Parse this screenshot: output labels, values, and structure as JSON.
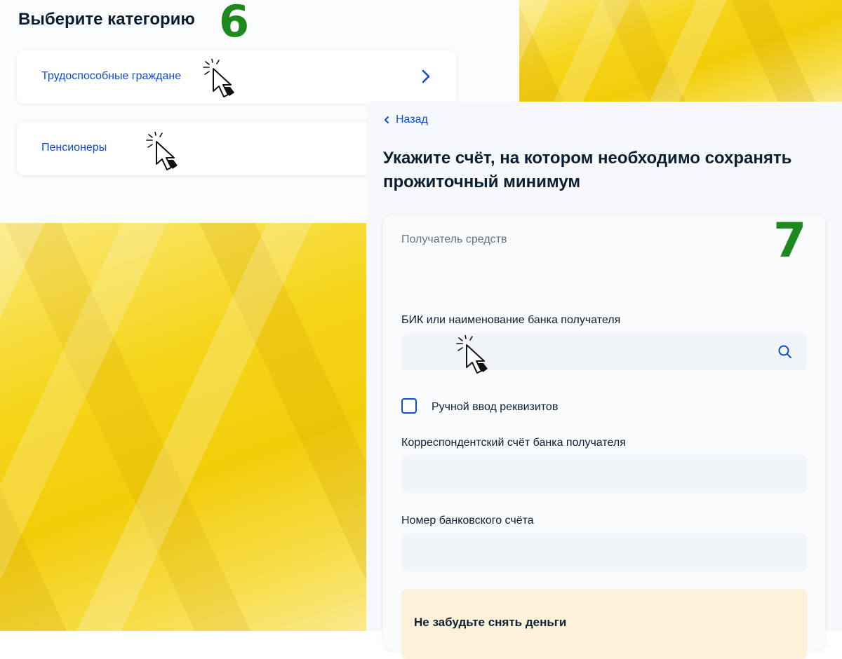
{
  "step6": {
    "number": "6",
    "title": "Выберите категорию",
    "categories": [
      {
        "label": "Трудоспособные граждане"
      },
      {
        "label": "Пенсионеры"
      }
    ]
  },
  "step7": {
    "number": "7",
    "back_label": "Назад",
    "title": "Укажите счёт, на котором необходимо сохранять прожиточный минимум",
    "form": {
      "recipient_label": "Получатель средств",
      "bank_label": "БИК или наименование банка получателя",
      "manual_entry_label": "Ручной ввод реквизитов",
      "manual_entry_checked": false,
      "corr_account_label": "Корреспондентский счёт банка получателя",
      "account_number_label": "Номер банковского счёта"
    },
    "notice_title": "Не забудьте снять деньги"
  },
  "colors": {
    "accent": "#0d4cd3",
    "step_number": "#1e8a1e",
    "notice_bg": "#fdf1da",
    "input_bg": "#f1f4f8"
  },
  "icons": [
    "chevron-right-icon",
    "chevron-left-icon",
    "search-icon",
    "click-cursor-icon"
  ]
}
